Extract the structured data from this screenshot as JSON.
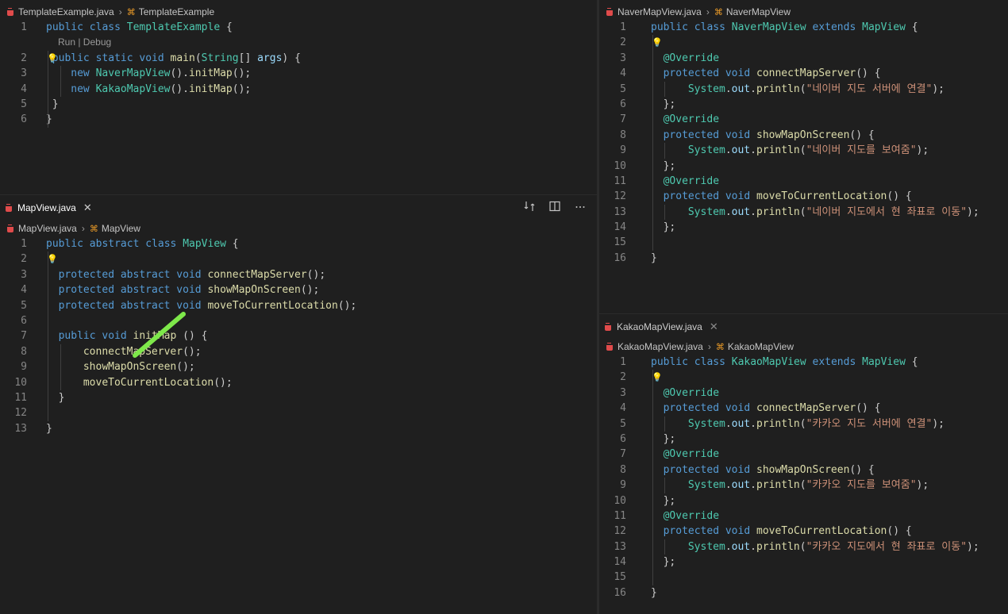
{
  "editors": {
    "template": {
      "breadcrumb": {
        "file": "TemplateExample.java",
        "symbol": "TemplateExample"
      },
      "codelens": "Run | Debug",
      "lines": [
        [
          [
            "kw",
            "public class "
          ],
          [
            "ty",
            "TemplateExample"
          ],
          [
            "pu",
            " {"
          ]
        ],
        [
          [
            "kw",
            "public static void "
          ],
          [
            "fn",
            "main"
          ],
          [
            "pu",
            "("
          ],
          [
            "ty",
            "String"
          ],
          [
            "pu",
            "[] "
          ],
          [
            "pl",
            "args"
          ],
          [
            "pu",
            ") {"
          ]
        ],
        [
          [
            "pu",
            "  "
          ],
          [
            "kw",
            "new "
          ],
          [
            "ty",
            "NaverMapView"
          ],
          [
            "pu",
            "()."
          ],
          [
            "fn",
            "initMap"
          ],
          [
            "pu",
            "();"
          ]
        ],
        [
          [
            "pu",
            "  "
          ],
          [
            "kw",
            "new "
          ],
          [
            "ty",
            "KakaoMapView"
          ],
          [
            "pu",
            "()."
          ],
          [
            "fn",
            "initMap"
          ],
          [
            "pu",
            "();"
          ]
        ],
        [
          [
            "pu",
            "}"
          ]
        ],
        [
          [
            "pu",
            "}"
          ]
        ]
      ],
      "line_numbers": [
        "1",
        "2",
        "3",
        "4",
        "5",
        "6"
      ]
    },
    "mapview": {
      "tab": {
        "label": "MapView.java",
        "close": "✕"
      },
      "breadcrumb": {
        "file": "MapView.java",
        "symbol": "MapView"
      },
      "lines": [
        [
          [
            "kw",
            "public abstract class "
          ],
          [
            "ty",
            "MapView"
          ],
          [
            "pu",
            " {"
          ]
        ],
        [],
        [
          [
            "kw",
            "protected abstract void "
          ],
          [
            "fn",
            "connectMapServer"
          ],
          [
            "pu",
            "();"
          ]
        ],
        [
          [
            "kw",
            "protected abstract void "
          ],
          [
            "fn",
            "showMapOnScreen"
          ],
          [
            "pu",
            "();"
          ]
        ],
        [
          [
            "kw",
            "protected abstract void "
          ],
          [
            "fn",
            "moveToCurrentLocation"
          ],
          [
            "pu",
            "();"
          ]
        ],
        [],
        [
          [
            "kw",
            "public void "
          ],
          [
            "fn",
            "initMap"
          ],
          [
            "pu",
            " () {"
          ]
        ],
        [
          [
            "pu",
            "  "
          ],
          [
            "fn",
            "connectMapServer"
          ],
          [
            "pu",
            "();"
          ]
        ],
        [
          [
            "pu",
            "  "
          ],
          [
            "fn",
            "showMapOnScreen"
          ],
          [
            "pu",
            "();"
          ]
        ],
        [
          [
            "pu",
            "  "
          ],
          [
            "fn",
            "moveToCurrentLocation"
          ],
          [
            "pu",
            "();"
          ]
        ],
        [
          [
            "pu",
            "}"
          ]
        ],
        [],
        [
          [
            "pu",
            "}"
          ]
        ]
      ],
      "line_numbers": [
        "1",
        "2",
        "3",
        "4",
        "5",
        "6",
        "7",
        "8",
        "9",
        "10",
        "11",
        "12",
        "13"
      ]
    },
    "naver": {
      "breadcrumb": {
        "file": "NaverMapView.java",
        "symbol": "NaverMapView"
      },
      "lines": [
        [
          [
            "kw",
            "public class "
          ],
          [
            "ty",
            "NaverMapView "
          ],
          [
            "kw",
            "extends "
          ],
          [
            "ty",
            "MapView"
          ],
          [
            "pu",
            " {"
          ]
        ],
        [],
        [
          [
            "an",
            "@Override"
          ]
        ],
        [
          [
            "kw",
            "protected void "
          ],
          [
            "fn",
            "connectMapServer"
          ],
          [
            "pu",
            "() {"
          ]
        ],
        [
          [
            "pu",
            "  "
          ],
          [
            "ty",
            "System"
          ],
          [
            "pu",
            "."
          ],
          [
            "pl",
            "out"
          ],
          [
            "pu",
            "."
          ],
          [
            "fn",
            "println"
          ],
          [
            "pu",
            "("
          ],
          [
            "st",
            "\"네이버 지도 서버에 연결\""
          ],
          [
            "pu",
            ");"
          ]
        ],
        [
          [
            "pu",
            "};"
          ]
        ],
        [
          [
            "an",
            "@Override"
          ]
        ],
        [
          [
            "kw",
            "protected void "
          ],
          [
            "fn",
            "showMapOnScreen"
          ],
          [
            "pu",
            "() {"
          ]
        ],
        [
          [
            "pu",
            "  "
          ],
          [
            "ty",
            "System"
          ],
          [
            "pu",
            "."
          ],
          [
            "pl",
            "out"
          ],
          [
            "pu",
            "."
          ],
          [
            "fn",
            "println"
          ],
          [
            "pu",
            "("
          ],
          [
            "st",
            "\"네이버 지도를 보여줌\""
          ],
          [
            "pu",
            ");"
          ]
        ],
        [
          [
            "pu",
            "};"
          ]
        ],
        [
          [
            "an",
            "@Override"
          ]
        ],
        [
          [
            "kw",
            "protected void "
          ],
          [
            "fn",
            "moveToCurrentLocation"
          ],
          [
            "pu",
            "() {"
          ]
        ],
        [
          [
            "pu",
            "  "
          ],
          [
            "ty",
            "System"
          ],
          [
            "pu",
            "."
          ],
          [
            "pl",
            "out"
          ],
          [
            "pu",
            "."
          ],
          [
            "fn",
            "println"
          ],
          [
            "pu",
            "("
          ],
          [
            "st",
            "\"네이버 지도에서 현 좌표로 이동\""
          ],
          [
            "pu",
            ");"
          ]
        ],
        [
          [
            "pu",
            "};"
          ]
        ],
        [],
        [
          [
            "pu",
            "}"
          ]
        ]
      ],
      "line_numbers": [
        "1",
        "2",
        "3",
        "4",
        "5",
        "6",
        "7",
        "8",
        "9",
        "10",
        "11",
        "12",
        "13",
        "14",
        "15",
        "16"
      ]
    },
    "kakao": {
      "tab": {
        "label": "KakaoMapView.java",
        "close": "✕"
      },
      "breadcrumb": {
        "file": "KakaoMapView.java",
        "symbol": "KakaoMapView"
      },
      "lines": [
        [
          [
            "kw",
            "public class "
          ],
          [
            "ty",
            "KakaoMapView "
          ],
          [
            "kw",
            "extends "
          ],
          [
            "ty",
            "MapView"
          ],
          [
            "pu",
            " {"
          ]
        ],
        [],
        [
          [
            "an",
            "@Override"
          ]
        ],
        [
          [
            "kw",
            "protected void "
          ],
          [
            "fn",
            "connectMapServer"
          ],
          [
            "pu",
            "() {"
          ]
        ],
        [
          [
            "pu",
            "  "
          ],
          [
            "ty",
            "System"
          ],
          [
            "pu",
            "."
          ],
          [
            "pl",
            "out"
          ],
          [
            "pu",
            "."
          ],
          [
            "fn",
            "println"
          ],
          [
            "pu",
            "("
          ],
          [
            "st",
            "\"카카오 지도 서버에 연결\""
          ],
          [
            "pu",
            ");"
          ]
        ],
        [
          [
            "pu",
            "};"
          ]
        ],
        [
          [
            "an",
            "@Override"
          ]
        ],
        [
          [
            "kw",
            "protected void "
          ],
          [
            "fn",
            "showMapOnScreen"
          ],
          [
            "pu",
            "() {"
          ]
        ],
        [
          [
            "pu",
            "  "
          ],
          [
            "ty",
            "System"
          ],
          [
            "pu",
            "."
          ],
          [
            "pl",
            "out"
          ],
          [
            "pu",
            "."
          ],
          [
            "fn",
            "println"
          ],
          [
            "pu",
            "("
          ],
          [
            "st",
            "\"카카오 지도를 보여줌\""
          ],
          [
            "pu",
            ");"
          ]
        ],
        [
          [
            "pu",
            "};"
          ]
        ],
        [
          [
            "an",
            "@Override"
          ]
        ],
        [
          [
            "kw",
            "protected void "
          ],
          [
            "fn",
            "moveToCurrentLocation"
          ],
          [
            "pu",
            "() {"
          ]
        ],
        [
          [
            "pu",
            "  "
          ],
          [
            "ty",
            "System"
          ],
          [
            "pu",
            "."
          ],
          [
            "pl",
            "out"
          ],
          [
            "pu",
            "."
          ],
          [
            "fn",
            "println"
          ],
          [
            "pu",
            "("
          ],
          [
            "st",
            "\"카카오 지도에서 현 좌표로 이동\""
          ],
          [
            "pu",
            ");"
          ]
        ],
        [
          [
            "pu",
            "};"
          ]
        ],
        [],
        [
          [
            "pu",
            "}"
          ]
        ]
      ],
      "line_numbers": [
        "1",
        "2",
        "3",
        "4",
        "5",
        "6",
        "7",
        "8",
        "9",
        "10",
        "11",
        "12",
        "13",
        "14",
        "15",
        "16"
      ]
    }
  },
  "icons": {
    "java_file": "java-file-icon",
    "class_symbol": "class-symbol-icon",
    "lightbulb": "lightbulb-icon",
    "compare_changes": "compare-changes-icon",
    "split_editor": "split-editor-icon",
    "more_actions": "more-actions-icon"
  },
  "colors": {
    "keyword": "#569cd6",
    "type": "#4ec9b0",
    "function": "#dcdcaa",
    "string": "#ce9178",
    "annotation_arrow": "#7ee84a"
  }
}
